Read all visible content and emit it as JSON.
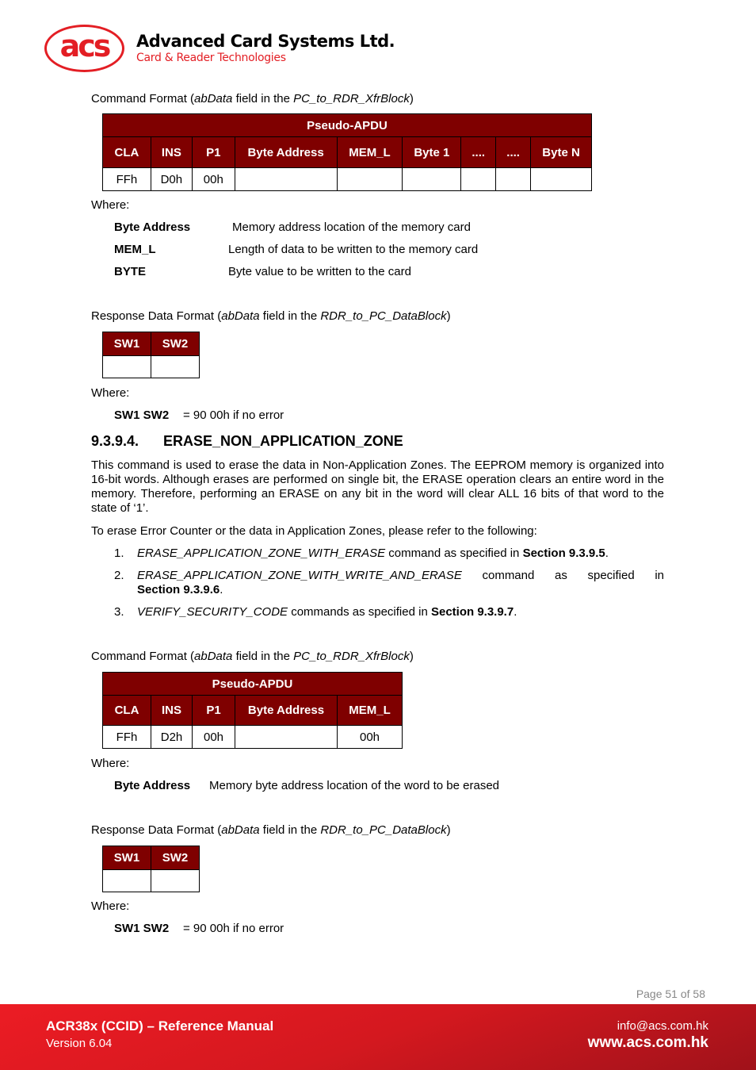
{
  "header": {
    "logo_text": "acs",
    "company": "Advanced Card Systems Ltd.",
    "tagline": "Card & Reader Technologies"
  },
  "section1": {
    "cmd_format": {
      "pre": "Command Format (",
      "italic1": "abData",
      "mid": " field in the ",
      "italic2": "PC_to_RDR_XfrBlock",
      "post": ")"
    },
    "table": {
      "title": "Pseudo-APDU",
      "headers": [
        "CLA",
        "INS",
        "P1",
        "Byte Address",
        "MEM_L",
        "Byte 1",
        "....",
        "....",
        "Byte N"
      ],
      "row": [
        "FFh",
        "D0h",
        "00h",
        "",
        "",
        "",
        "",
        "",
        ""
      ]
    },
    "where": "Where:",
    "defs": [
      {
        "term": "Byte Address",
        "desc": "Memory address location of the memory card"
      },
      {
        "term": "MEM_L",
        "desc": "Length of data to be written to the memory card"
      },
      {
        "term": "BYTE",
        "desc": "Byte value to be written to the card"
      }
    ],
    "resp_format": {
      "pre": "Response Data Format (",
      "italic1": "abData",
      "mid": " field in the ",
      "italic2": "RDR_to_PC_DataBlock",
      "post": ")"
    },
    "resp_table": {
      "headers": [
        "SW1",
        "SW2"
      ]
    },
    "where2": "Where:",
    "sw": {
      "term": "SW1 SW2",
      "desc": "= 90 00h if no error"
    }
  },
  "section2": {
    "number": "9.3.9.4.",
    "title": "ERASE_NON_APPLICATION_ZONE",
    "para1": "This command is used to erase the data in Non-Application Zones. The EEPROM memory is organized into 16-bit words. Although erases are performed on single bit, the ERASE operation clears an entire word in the memory. Therefore, performing an ERASE on any bit in the word will clear ALL 16 bits of that word to the state of ‘1’.",
    "para2": "To erase Error Counter or the data in Application Zones, please refer to the following:",
    "list": [
      {
        "num": "1.",
        "italic": "ERASE_APPLICATION_ZONE_WITH_ERASE",
        "text": " command as specified in ",
        "bold": "Section 9.3.9.5",
        "end": "."
      },
      {
        "num": "2.",
        "italic": "ERASE_APPLICATION_ZONE_WITH_WRITE_AND_ERASE",
        "text": " command as specified in ",
        "bold": "Section 9.3.9.6",
        "end": "."
      },
      {
        "num": "3.",
        "italic": "VERIFY_SECURITY_CODE",
        "text": " commands as specified in ",
        "bold": "Section 9.3.9.7",
        "end": "."
      }
    ],
    "cmd_format": {
      "pre": "Command Format (",
      "italic1": "abData",
      "mid": " field in the ",
      "italic2": "PC_to_RDR_XfrBlock",
      "post": ")"
    },
    "table": {
      "title": "Pseudo-APDU",
      "headers": [
        "CLA",
        "INS",
        "P1",
        "Byte Address",
        "MEM_L"
      ],
      "row": [
        "FFh",
        "D2h",
        "00h",
        "",
        "00h"
      ]
    },
    "where": "Where:",
    "defs": [
      {
        "term": "Byte Address",
        "desc": "Memory byte address location of the word to be erased"
      }
    ],
    "resp_format": {
      "pre": "Response Data Format (",
      "italic1": "abData",
      "mid": " field in the ",
      "italic2": "RDR_to_PC_DataBlock",
      "post": ")"
    },
    "resp_table": {
      "headers": [
        "SW1",
        "SW2"
      ]
    },
    "where2": "Where:",
    "sw": {
      "term": "SW1 SW2",
      "desc": "= 90 00h if no error"
    }
  },
  "page_number": "Page 51 of 58",
  "footer": {
    "title": "ACR38x (CCID) – Reference Manual",
    "version": "Version 6.04",
    "email": "info@acs.com.hk",
    "website": "www.acs.com.hk",
    "color": "#e31e24"
  }
}
